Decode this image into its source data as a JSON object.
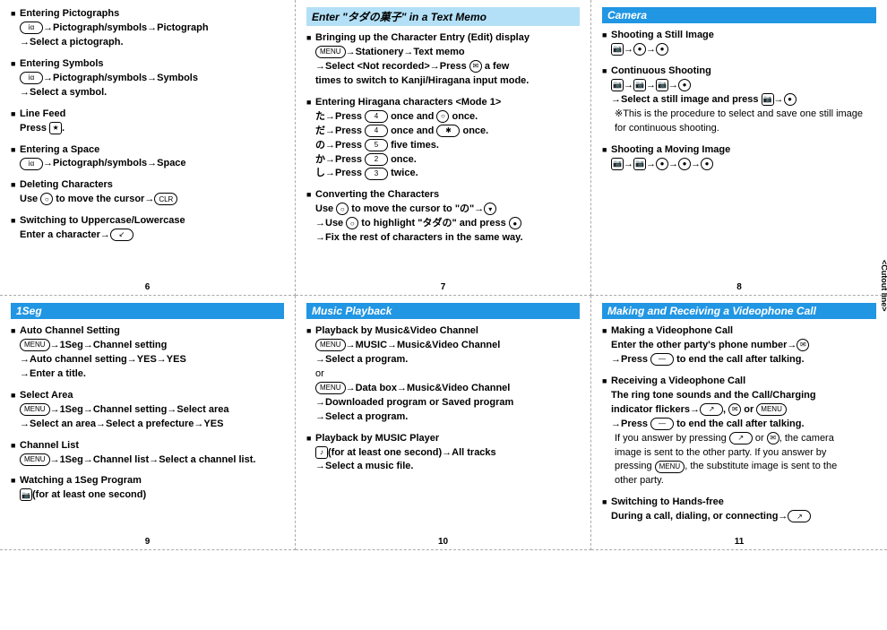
{
  "cells": {
    "c6": {
      "page": "6",
      "sections": [
        {
          "title": "Entering Pictographs",
          "lines": [
            "[ia]→Pictograph/symbols→Pictograph",
            "→Select a pictograph."
          ]
        },
        {
          "title": "Entering Symbols",
          "lines": [
            "[ia]→Pictograph/symbols→Symbols",
            "→Select a symbol."
          ]
        },
        {
          "title": "Line Feed",
          "lines": [
            "Press [★]."
          ]
        },
        {
          "title": "Entering a Space",
          "lines": [
            "[ia]→Pictograph/symbols→Space"
          ]
        },
        {
          "title": "Deleting Characters",
          "lines": [
            "Use [○] to move the cursor→[CLR]"
          ]
        },
        {
          "title": "Switching to Uppercase/Lowercase",
          "lines": [
            "Enter a character→[↙]"
          ]
        }
      ]
    },
    "c7": {
      "page": "7",
      "banner": "Enter \"タダの菓子\" in a Text Memo",
      "bannerClass": "banner-light",
      "sections": [
        {
          "title": "Bringing up the Character Entry (Edit) display",
          "lines": [
            "[MENU]→Stationery→Text memo",
            "→Select <Not recorded>→Press [✉] a few",
            "times to switch to Kanji/Hiragana input mode."
          ]
        },
        {
          "title": "Entering Hiragana characters <Mode 1>",
          "lines": [
            "た→Press [4] once and [○] once.",
            "だ→Press [4] once and [✱] once.",
            "の→Press [5] five times.",
            "か→Press [2] once.",
            "し→Press [3] twice."
          ]
        },
        {
          "title": "Converting the Characters",
          "lines": [
            "Use [○] to move the cursor to \"の\"→[▾]",
            "→Use [○] to highlight \"タダの\" and press [●]",
            "→Fix the rest of characters in the same way."
          ]
        }
      ]
    },
    "c8": {
      "page": "8",
      "banner": "Camera",
      "bannerClass": "banner-blue",
      "cutout": "<Cutout line>",
      "sections": [
        {
          "title": "Shooting a Still Image",
          "lines": [
            "[📷]→[●]→[●]"
          ]
        },
        {
          "title": "Continuous Shooting",
          "lines": [
            "[📷]→[📷]→[📷]→[●]",
            "→Select a still image and press [📷]→[●]"
          ],
          "note": "※This is the procedure to select and save one still image for continuous shooting."
        },
        {
          "title": "Shooting a Moving Image",
          "lines": [
            "[📷]→[📷]→[●]→[●]→[●]"
          ]
        }
      ]
    },
    "c9": {
      "page": "9",
      "banner": "1Seg",
      "bannerClass": "banner-blue",
      "sections": [
        {
          "title": "Auto Channel Setting",
          "lines": [
            "[MENU]→1Seg→Channel setting",
            "→Auto channel setting→YES→YES",
            "→Enter a title."
          ]
        },
        {
          "title": "Select Area",
          "lines": [
            "[MENU]→1Seg→Channel setting→Select area",
            "→Select an area→Select a prefecture→YES"
          ]
        },
        {
          "title": "Channel List",
          "lines": [
            "[MENU]→1Seg→Channel list→Select a channel list."
          ]
        },
        {
          "title": "Watching a 1Seg Program",
          "lines": [
            "[📷](for at least one second)"
          ]
        }
      ]
    },
    "c10": {
      "page": "10",
      "banner": "Music Playback",
      "bannerClass": "banner-blue",
      "sections": [
        {
          "title": "Playback by Music&Video Channel",
          "lines": [
            "[MENU]→MUSIC→Music&Video Channel",
            "→Select a program."
          ],
          "suffix": "or",
          "lines2": [
            "[MENU]→Data box→Music&Video Channel",
            "→Downloaded program or Saved program",
            "→Select a program."
          ]
        },
        {
          "title": "Playback by MUSIC Player",
          "lines": [
            "[♪](for at least one second)→All tracks",
            "→Select a music file."
          ]
        }
      ]
    },
    "c11": {
      "page": "11",
      "banner": "Making and Receiving a Videophone Call",
      "bannerClass": "banner-blue",
      "sections": [
        {
          "title": "Making a Videophone Call",
          "lines": [
            "Enter the other party's phone number→[✉]",
            "→Press [―] to end the call after talking."
          ]
        },
        {
          "title": "Receiving a Videophone Call",
          "lines": [
            "The ring tone sounds and the Call/Charging",
            "indicator flickers→[↗], [✉] or [MENU]",
            "→Press [―] to end the call after talking."
          ],
          "noteLines": [
            "If you answer by pressing [↗] or [✉], the camera",
            "image is sent to the other party. If you answer by",
            "pressing [MENU], the substitute image is sent to the",
            "other party."
          ]
        },
        {
          "title": "Switching to Hands-free",
          "lines": [
            "During a call, dialing, or connecting→[↗]"
          ]
        }
      ]
    }
  }
}
